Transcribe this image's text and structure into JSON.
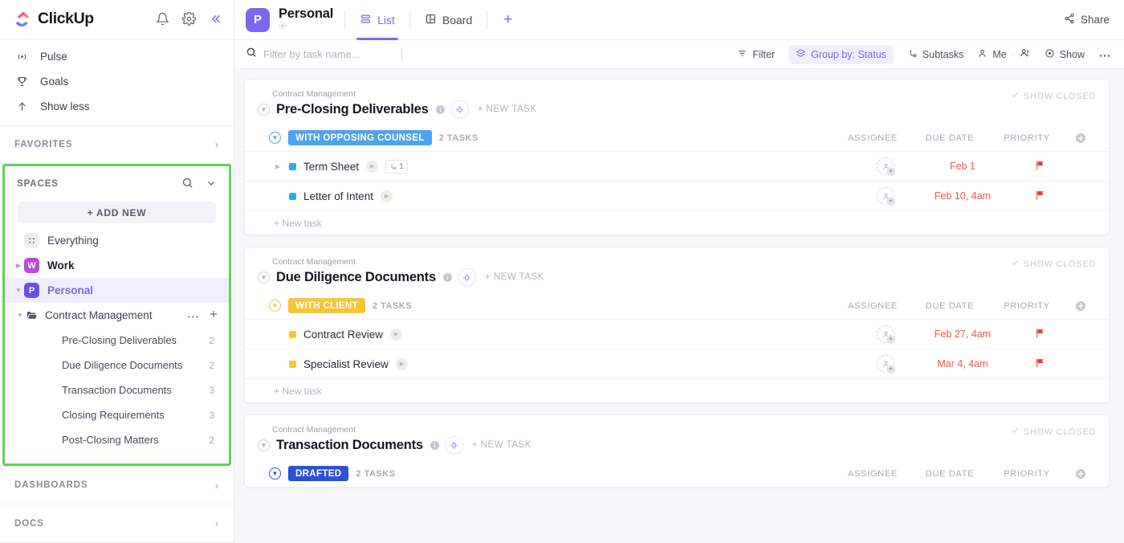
{
  "brand": {
    "name": "ClickUp",
    "accent": "#7b68ee",
    "highlight_border": "#5fd455"
  },
  "sidebar": {
    "nav_items": [
      {
        "label": "Pulse",
        "icon": "pulse-icon"
      },
      {
        "label": "Goals",
        "icon": "trophy-icon"
      },
      {
        "label": "Show less",
        "icon": "arrow-up-icon"
      }
    ],
    "favorites_label": "FAVORITES",
    "spaces": {
      "title": "SPACES",
      "add_new_label": "+ ADD NEW",
      "items": [
        {
          "label": "Everything",
          "badge": "",
          "color": "#ededf2",
          "selected": false,
          "bold": false
        },
        {
          "label": "Work",
          "badge": "W",
          "color": "#bb4ad8",
          "selected": false,
          "bold": true
        },
        {
          "label": "Personal",
          "badge": "P",
          "color": "#6b4ee8",
          "selected": true,
          "bold": true
        }
      ],
      "folder": {
        "label": "Contract Management",
        "lists": [
          {
            "label": "Pre-Closing Deliverables",
            "count": "2"
          },
          {
            "label": "Due Diligence Documents",
            "count": "2"
          },
          {
            "label": "Transaction Documents",
            "count": "3"
          },
          {
            "label": "Closing Requirements",
            "count": "3"
          },
          {
            "label": "Post-Closing Matters",
            "count": "2"
          }
        ]
      }
    },
    "dashboards_label": "DASHBOARDS",
    "docs_label": "DOCS"
  },
  "header": {
    "project_badge": "P",
    "project_title": "Personal",
    "tabs": [
      {
        "label": "List",
        "icon": "list-icon",
        "active": true
      },
      {
        "label": "Board",
        "icon": "board-icon",
        "active": false
      }
    ],
    "add_view_label": "+",
    "share_label": "Share"
  },
  "filter_bar": {
    "search_placeholder": "Filter by task name...",
    "search_value": "",
    "items": [
      {
        "label": "Filter",
        "icon": "filter-icon",
        "pill": false
      },
      {
        "label": "Group by: Status",
        "icon": "layers-icon",
        "pill": true
      },
      {
        "label": "Subtasks",
        "icon": "subtask-icon",
        "pill": false
      },
      {
        "label": "Me",
        "icon": "person-icon",
        "pill": false
      },
      {
        "label": "Show",
        "icon": "eye-icon",
        "pill": false
      }
    ],
    "more_label": "•••"
  },
  "columns": {
    "assignee": "ASSIGNEE",
    "due_date": "DUE DATE",
    "priority": "PRIORITY"
  },
  "common": {
    "breadcrumb": "Contract Management",
    "new_task_label": "+ NEW TASK",
    "show_closed_label": "SHOW CLOSED",
    "new_task_row_label": "+ New task",
    "task_count_label": "2 TASKS"
  },
  "groups": [
    {
      "breadcrumb": "Contract Management",
      "title": "Pre-Closing Deliverables",
      "status": {
        "label": "WITH OPPOSING COUNSEL",
        "color": "#4da3f0",
        "border": "#4da3f0"
      },
      "task_count": "2 TASKS",
      "tasks": [
        {
          "name": "Term Sheet",
          "status_color": "#2ea8f0",
          "has_arrow": true,
          "subtask_count": "1",
          "due_date": "Feb 1",
          "priority": "urgent"
        },
        {
          "name": "Letter of Intent",
          "status_color": "#2ea8f0",
          "has_arrow": false,
          "subtask_count": "",
          "due_date": "Feb 10, 4am",
          "priority": "urgent"
        }
      ]
    },
    {
      "breadcrumb": "Contract Management",
      "title": "Due Diligence Documents",
      "status": {
        "label": "WITH CLIENT",
        "color": "#f5c638",
        "border": "#f5c638"
      },
      "task_count": "2 TASKS",
      "tasks": [
        {
          "name": "Contract Review",
          "status_color": "#f5c638",
          "has_arrow": false,
          "subtask_count": "",
          "due_date": "Feb 27, 4am",
          "priority": "urgent"
        },
        {
          "name": "Specialist Review",
          "status_color": "#f5c638",
          "has_arrow": false,
          "subtask_count": "",
          "due_date": "Mar 4, 4am",
          "priority": "urgent"
        }
      ]
    },
    {
      "breadcrumb": "Contract Management",
      "title": "Transaction Documents",
      "status": {
        "label": "DRAFTED",
        "color": "#2a52d8",
        "border": "#2a52d8"
      },
      "task_count": "2 TASKS",
      "tasks": []
    }
  ]
}
